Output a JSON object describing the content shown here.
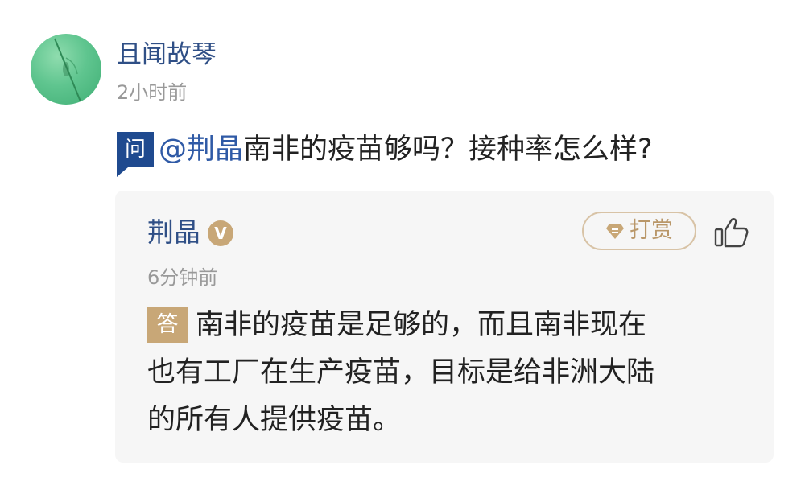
{
  "asker": {
    "name": "且闻故琴",
    "time": "2小时前",
    "avatar_color": "#5fc58f"
  },
  "question": {
    "badge": "问",
    "mention": "@荆晶",
    "text": "南非的疫苗够吗？接种率怎么样?"
  },
  "answer": {
    "author": "荆晶",
    "verified_badge": "V",
    "time": "6分钟前",
    "tip_label": "打赏",
    "badge": "答",
    "lines": [
      "南非的疫苗是足够的，而且南非现在",
      "也有工厂在生产疫苗，目标是给非洲大陆",
      "的所有人提供疫苗。"
    ]
  },
  "colors": {
    "name_blue": "#2f4f86",
    "question_badge": "#1f4a8f",
    "mention_blue": "#2f5aa6",
    "gold": "#c8a777",
    "card_bg": "#f6f6f6"
  },
  "icons": {
    "tip": "diamond-icon",
    "like": "thumbs-up-icon"
  }
}
